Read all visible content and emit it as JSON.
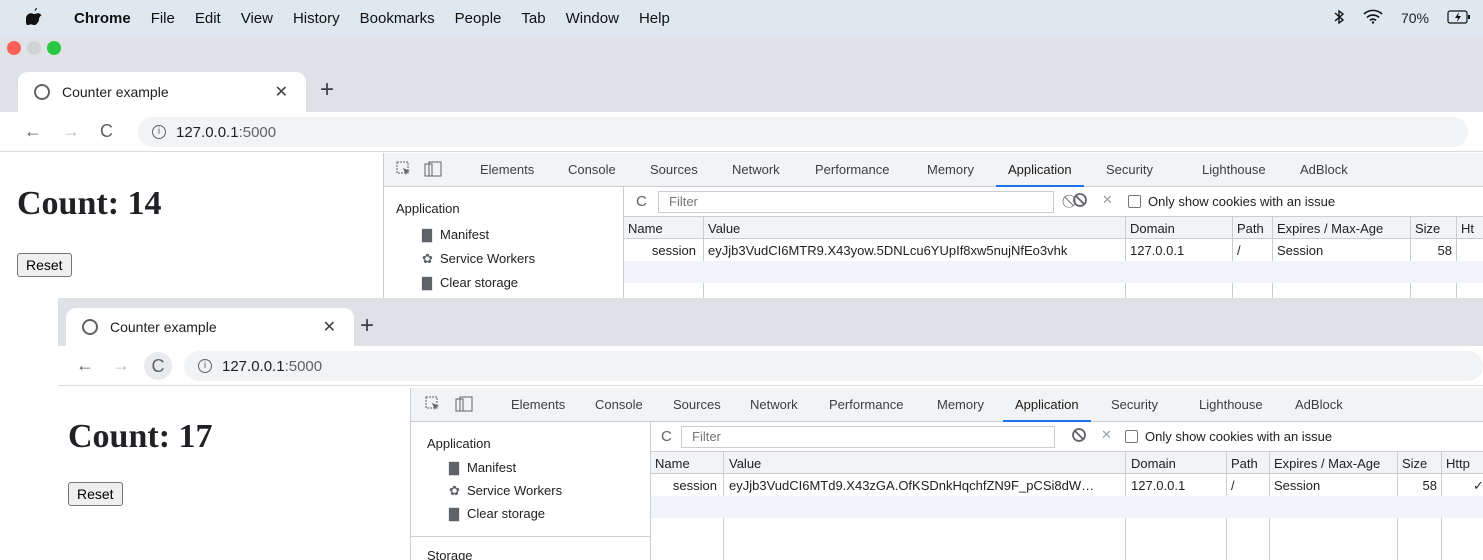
{
  "menubar": {
    "app": "Chrome",
    "items": [
      "File",
      "Edit",
      "View",
      "History",
      "Bookmarks",
      "People",
      "Tab",
      "Window",
      "Help"
    ],
    "battery": "70%"
  },
  "colors": {
    "red": "#fe5f57",
    "yellow": "#febc2e",
    "green": "#28c840",
    "accent": "#1a73e8"
  },
  "window1": {
    "tab_title": "Counter example",
    "url_host": "127.0.0.1",
    "url_port": ":5000",
    "count_text": "Count: 14",
    "reset_label": "Reset",
    "devtools": {
      "tabs": [
        "Elements",
        "Console",
        "Sources",
        "Network",
        "Performance",
        "Memory",
        "Application",
        "Security",
        "Lighthouse",
        "AdBlock"
      ],
      "active_tab": "Application",
      "sidebar_title": "Application",
      "sidebar_items": [
        "Manifest",
        "Service Workers",
        "Clear storage"
      ],
      "filter_placeholder": "Filter",
      "only_issue_label": "Only show cookies with an issue",
      "columns": [
        "Name",
        "Value",
        "Domain",
        "Path",
        "Expires / Max-Age",
        "Size",
        "Ht"
      ],
      "cookie": {
        "name": "session",
        "value": "eyJjb3VudCI6MTR9.X43yow.5DNLcu6YUpIf8xw5nujNfEo3vhk",
        "domain": "127.0.0.1",
        "path": "/",
        "expires": "Session",
        "size": "58"
      }
    }
  },
  "window2": {
    "tab_title": "Counter example",
    "url_host": "127.0.0.1",
    "url_port": ":5000",
    "count_text": "Count: 17",
    "reset_label": "Reset",
    "devtools": {
      "tabs": [
        "Elements",
        "Console",
        "Sources",
        "Network",
        "Performance",
        "Memory",
        "Application",
        "Security",
        "Lighthouse",
        "AdBlock"
      ],
      "active_tab": "Application",
      "sidebar_title": "Application",
      "sidebar_items": [
        "Manifest",
        "Service Workers",
        "Clear storage"
      ],
      "sidebar_section": "Storage",
      "filter_placeholder": "Filter",
      "only_issue_label": "Only show cookies with an issue",
      "columns": [
        "Name",
        "Value",
        "Domain",
        "Path",
        "Expires / Max-Age",
        "Size",
        "Http"
      ],
      "cookie": {
        "name": "session",
        "value": "eyJjb3VudCI6MTd9.X43zGA.OfKSDnkHqchfZN9F_pCSi8dW…",
        "domain": "127.0.0.1",
        "path": "/",
        "expires": "Session",
        "size": "58",
        "http": "✓"
      }
    }
  }
}
